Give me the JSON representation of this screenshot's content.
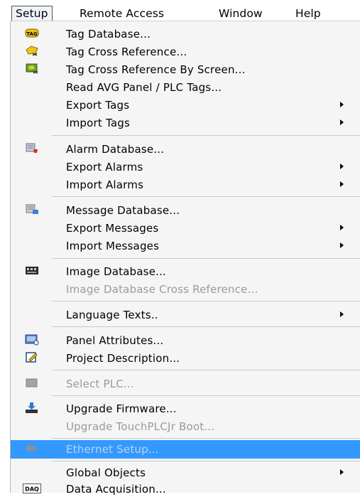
{
  "menubar": {
    "items": [
      "Setup",
      "Remote Access",
      "Window",
      "Help"
    ]
  },
  "setup_menu": {
    "items": [
      {
        "label": "Tag Database...",
        "icon": "tag-icon"
      },
      {
        "label": "Tag Cross Reference...",
        "icon": "tag-cross-reference-icon"
      },
      {
        "label": "Tag Cross Reference By Screen...",
        "icon": "tag-cross-reference-screen-icon"
      },
      {
        "label": "Read AVG Panel / PLC Tags..."
      },
      {
        "label": "Export Tags",
        "submenu": true
      },
      {
        "label": "Import Tags",
        "submenu": true
      },
      {
        "label": "Alarm Database...",
        "icon": "alarm-database-icon"
      },
      {
        "label": "Export Alarms",
        "submenu": true
      },
      {
        "label": "Import Alarms",
        "submenu": true
      },
      {
        "label": "Message Database...",
        "icon": "message-database-icon"
      },
      {
        "label": "Export Messages",
        "submenu": true
      },
      {
        "label": "Import Messages",
        "submenu": true
      },
      {
        "label": "Image Database...",
        "icon": "image-database-icon"
      },
      {
        "label": "Image Database Cross Reference...",
        "disabled": true
      },
      {
        "label": "Language Texts..",
        "submenu": true
      },
      {
        "label": "Panel Attributes...",
        "icon": "panel-attributes-icon"
      },
      {
        "label": "Project Description...",
        "icon": "project-description-icon"
      },
      {
        "label": "Select PLC...",
        "icon": "select-plc-icon",
        "disabled": true
      },
      {
        "label": "Upgrade Firmware...",
        "icon": "upgrade-firmware-icon"
      },
      {
        "label": "Upgrade TouchPLCJr Boot...",
        "disabled": true
      },
      {
        "label": "Ethernet Setup...",
        "icon": "ethernet-icon",
        "disabled": true,
        "highlighted": true
      },
      {
        "label": "Global Objects",
        "submenu": true
      },
      {
        "label": "Data Acquisition...",
        "icon": "data-acquisition-icon"
      }
    ],
    "tag_icon_text": "TAG",
    "dao_icon_text": "DAQ"
  },
  "colors": {
    "highlight": "#3399ff",
    "menu_background": "#f5f5f5",
    "disabled_text": "#9a9a9a"
  }
}
